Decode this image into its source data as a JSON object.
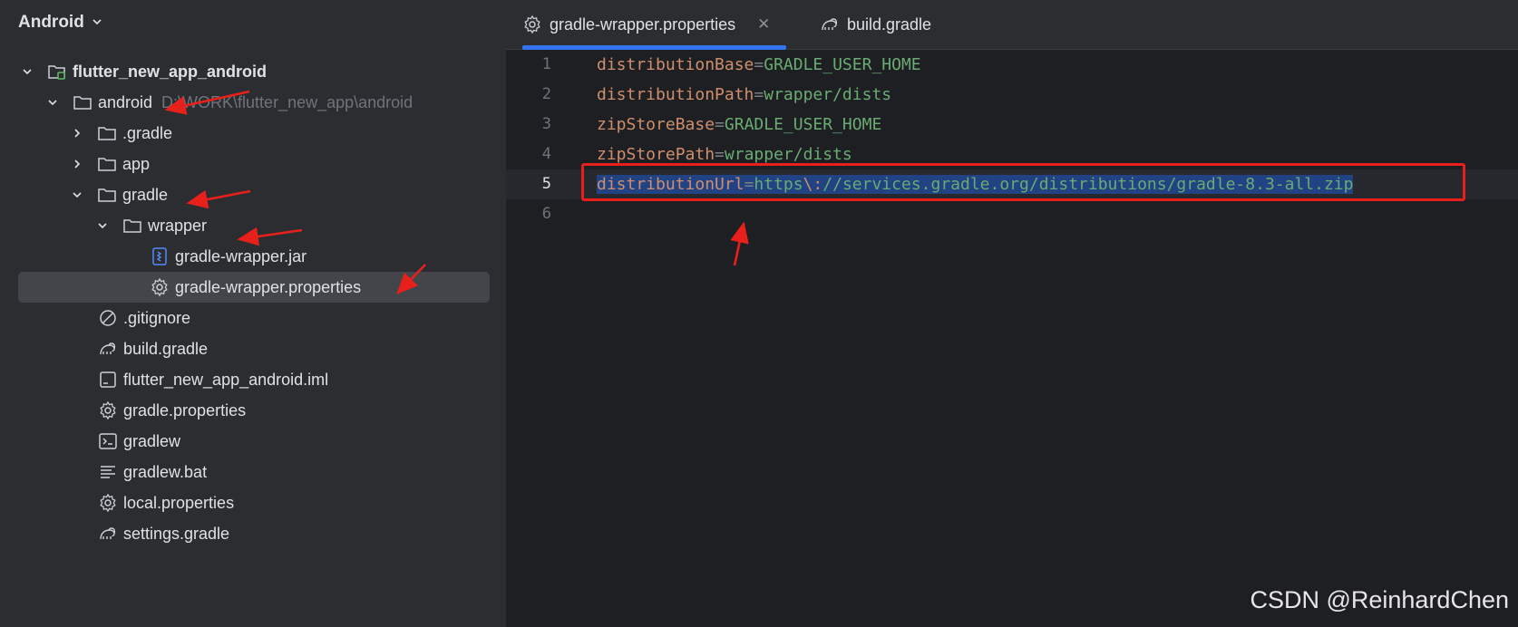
{
  "project_panel": {
    "view_selector": "Android",
    "tree": [
      {
        "label": "flutter_new_app_android",
        "icon": "module-folder-icon",
        "expanded": true
      },
      {
        "label": "android",
        "hint": "D:\\WORK\\flutter_new_app\\android",
        "icon": "folder-icon",
        "expanded": true
      },
      {
        "label": ".gradle",
        "icon": "folder-icon",
        "expanded": false
      },
      {
        "label": "app",
        "icon": "folder-icon",
        "expanded": false
      },
      {
        "label": "gradle",
        "icon": "folder-icon",
        "expanded": true
      },
      {
        "label": "wrapper",
        "icon": "folder-icon",
        "expanded": true
      },
      {
        "label": "gradle-wrapper.jar",
        "icon": "jar-icon"
      },
      {
        "label": "gradle-wrapper.properties",
        "icon": "gear-icon",
        "selected": true
      },
      {
        "label": ".gitignore",
        "icon": "gitignore-icon"
      },
      {
        "label": "build.gradle",
        "icon": "gradle-elephant-icon"
      },
      {
        "label": "flutter_new_app_android.iml",
        "icon": "iml-file-icon"
      },
      {
        "label": "gradle.properties",
        "icon": "gear-icon"
      },
      {
        "label": "gradlew",
        "icon": "terminal-icon"
      },
      {
        "label": "gradlew.bat",
        "icon": "text-file-icon"
      },
      {
        "label": "local.properties",
        "icon": "gear-icon"
      },
      {
        "label": "settings.gradle",
        "icon": "gradle-elephant-icon"
      }
    ]
  },
  "editor": {
    "tabs": [
      {
        "label": "gradle-wrapper.properties",
        "icon": "gear-icon",
        "active": true,
        "close": "✕"
      },
      {
        "label": "build.gradle",
        "icon": "gradle-elephant-icon",
        "active": false
      }
    ],
    "lines": [
      {
        "number": "1",
        "key": "distributionBase",
        "eq": "=",
        "value": "GRADLE_USER_HOME"
      },
      {
        "number": "2",
        "key": "distributionPath",
        "eq": "=",
        "value": "wrapper/dists"
      },
      {
        "number": "3",
        "key": "zipStoreBase",
        "eq": "=",
        "value": "GRADLE_USER_HOME"
      },
      {
        "number": "4",
        "key": "zipStorePath",
        "eq": "=",
        "value": "wrapper/dists"
      },
      {
        "number": "5",
        "key": "distributionUrl",
        "eq": "=",
        "value_a": "https",
        "escape": "\\:",
        "value_b": "//services.gradle.org/distributions/gradle-8.3-all.zip",
        "current": true
      },
      {
        "number": "6"
      }
    ]
  },
  "watermark": "CSDN @ReinhardChen",
  "colors": {
    "key": "#cf8e6d",
    "value": "#6aab73",
    "selection": "#214283",
    "annotation_red": "#e8201c",
    "accent": "#3574f0"
  }
}
